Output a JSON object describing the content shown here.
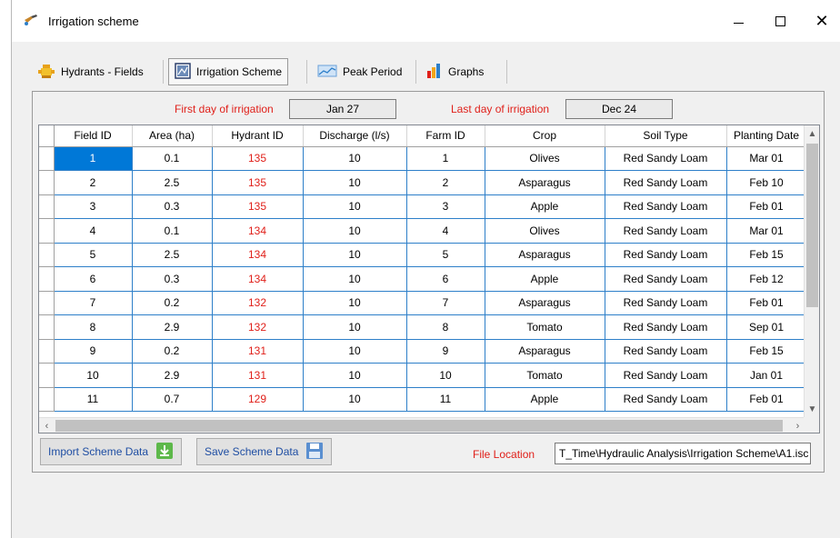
{
  "window": {
    "title": "Irrigation scheme"
  },
  "toolbar": {
    "items": [
      {
        "label": "Hydrants - Fields"
      },
      {
        "label": "Irrigation Scheme"
      },
      {
        "label": "Peak Period"
      },
      {
        "label": "Graphs"
      }
    ]
  },
  "dates": {
    "first_label": "First day of irrigation",
    "first_value": "Jan 27",
    "last_label": "Last day of irrigation",
    "last_value": "Dec 24"
  },
  "table": {
    "columns": [
      "Field ID",
      "Area (ha)",
      "Hydrant ID",
      "Discharge (l/s)",
      "Farm ID",
      "Crop",
      "Soil Type",
      "Planting Date"
    ],
    "rows": [
      [
        "1",
        "0.1",
        "135",
        "10",
        "1",
        "Olives",
        "Red Sandy Loam",
        "Mar 01"
      ],
      [
        "2",
        "2.5",
        "135",
        "10",
        "2",
        "Asparagus",
        "Red Sandy Loam",
        "Feb 10"
      ],
      [
        "3",
        "0.3",
        "135",
        "10",
        "3",
        "Apple",
        "Red Sandy Loam",
        "Feb 01"
      ],
      [
        "4",
        "0.1",
        "134",
        "10",
        "4",
        "Olives",
        "Red Sandy Loam",
        "Mar 01"
      ],
      [
        "5",
        "2.5",
        "134",
        "10",
        "5",
        "Asparagus",
        "Red Sandy Loam",
        "Feb 15"
      ],
      [
        "6",
        "0.3",
        "134",
        "10",
        "6",
        "Apple",
        "Red Sandy Loam",
        "Feb 12"
      ],
      [
        "7",
        "0.2",
        "132",
        "10",
        "7",
        "Asparagus",
        "Red Sandy Loam",
        "Feb 01"
      ],
      [
        "8",
        "2.9",
        "132",
        "10",
        "8",
        "Tomato",
        "Red Sandy Loam",
        "Sep 01"
      ],
      [
        "9",
        "0.2",
        "131",
        "10",
        "9",
        "Asparagus",
        "Red Sandy Loam",
        "Feb 15"
      ],
      [
        "10",
        "2.9",
        "131",
        "10",
        "10",
        "Tomato",
        "Red Sandy Loam",
        "Jan 01"
      ],
      [
        "11",
        "0.7",
        "129",
        "10",
        "11",
        "Apple",
        "Red Sandy Loam",
        "Feb 01"
      ]
    ]
  },
  "actions": {
    "import_label": "Import Scheme Data",
    "save_label": "Save Scheme Data"
  },
  "file": {
    "label": "File Location",
    "value": "T_Time\\Hydraulic Analysis\\Irrigation Scheme\\A1.isc"
  },
  "colors": {
    "accent_red": "#e0201a",
    "selection_blue": "#0078d7",
    "grid_line_blue": "#2d7fc9",
    "button_text_blue": "#1f4ea3"
  },
  "icons": {
    "app": "watering-can-icon",
    "hydrants": "hydrant-icon",
    "scheme": "scheme-icon",
    "peak": "peak-chart-icon",
    "graphs": "bar-chart-icon",
    "import": "download-arrow-icon",
    "save": "floppy-disk-icon"
  }
}
